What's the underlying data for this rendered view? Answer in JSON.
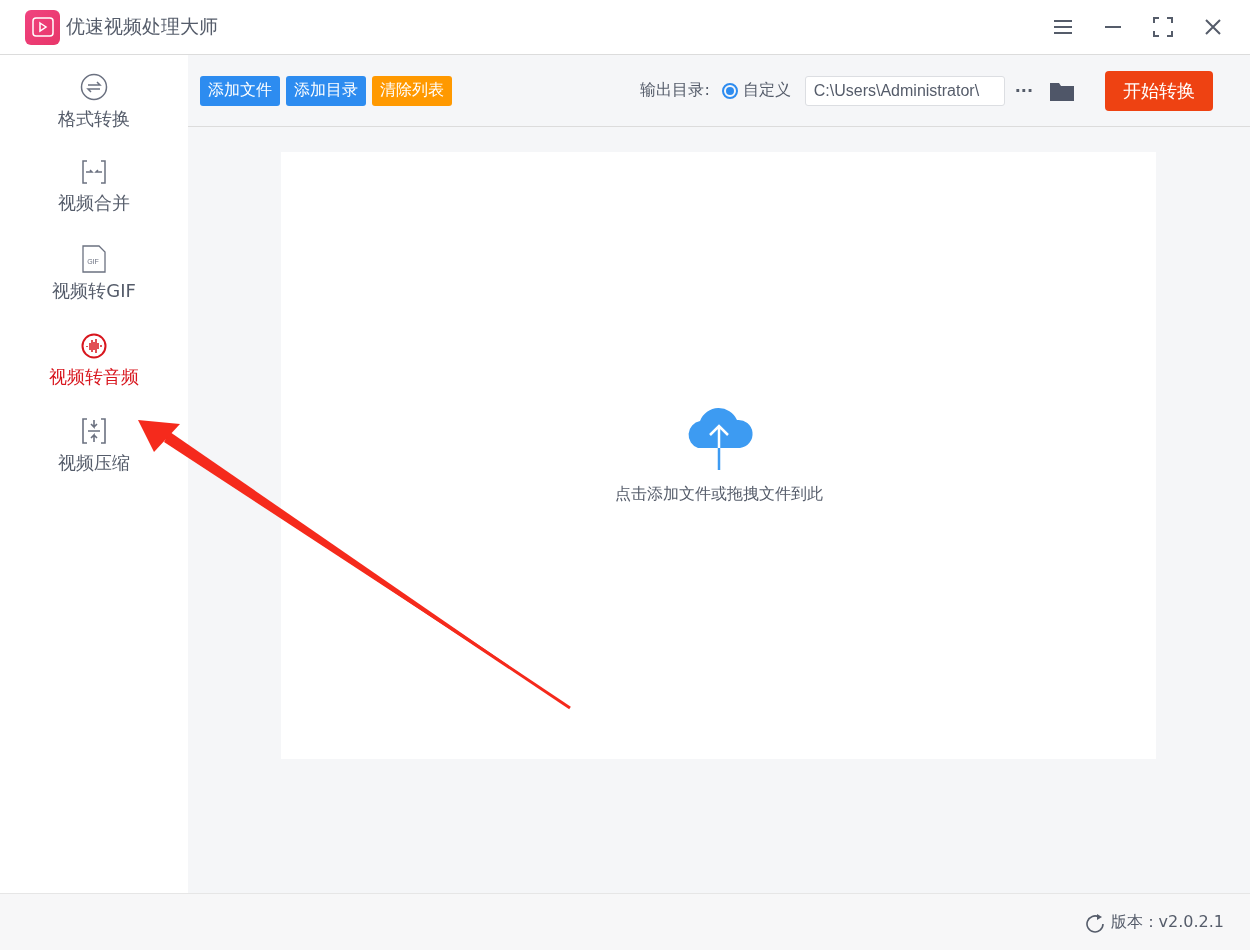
{
  "window": {
    "title": "优速视频处理大师"
  },
  "toolbar": {
    "buttons": [
      {
        "label": "添加文件",
        "kind": "blue"
      },
      {
        "label": "添加目录",
        "kind": "blue"
      },
      {
        "label": "清除列表",
        "kind": "orange"
      }
    ],
    "output_label": "输出目录:",
    "radio": {
      "label": "自定义",
      "selected": true
    },
    "path": "C:\\Users\\Administrator\\",
    "more": "···",
    "start": "开始转换"
  },
  "sidebar": {
    "items": [
      {
        "label": "格式转换",
        "kind": "convert",
        "selected": false
      },
      {
        "label": "视频合并",
        "kind": "merge",
        "selected": false
      },
      {
        "label": "视频转GIF",
        "kind": "gif",
        "icon_text": "GIF",
        "selected": false
      },
      {
        "label": "视频转音频",
        "kind": "audio",
        "selected": true
      },
      {
        "label": "视频压缩",
        "kind": "compress",
        "selected": false
      }
    ]
  },
  "dropzone": {
    "hint": "点击添加文件或拖拽文件到此"
  },
  "status_bar": {
    "version": "版本：v2.0.2.1"
  }
}
